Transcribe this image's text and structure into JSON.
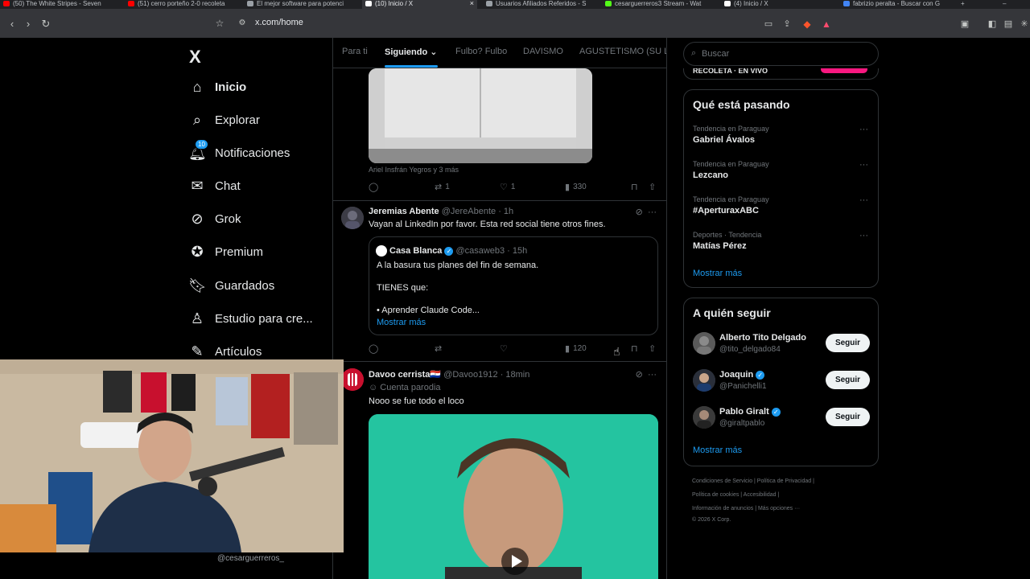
{
  "browser": {
    "tabs": [
      {
        "title": "(50) The White Stripes - Seven",
        "color": "#ff0000"
      },
      {
        "title": "(51) cerro porteño 2-0 recoleta",
        "color": "#ff0000"
      },
      {
        "title": "El mejor software para potenci",
        "color": "#9aa0a6"
      },
      {
        "title": "(10) Inicio / X",
        "color": "#ffffff",
        "active": true
      },
      {
        "title": "Usuarios Afiliados Referidos - S",
        "color": "#9aa0a6"
      },
      {
        "title": "cesarguerreros3 Stream - Wat",
        "color": "#53fc18"
      },
      {
        "title": "(4) Inicio / X",
        "color": "#ffffff"
      },
      {
        "title": "fabrizio peralta - Buscar con G",
        "color": "#4285f4"
      }
    ],
    "url": "x.com/home"
  },
  "nav": {
    "logo": "X",
    "items": [
      {
        "label": "Inicio",
        "icon": "home-icon"
      },
      {
        "label": "Explorar",
        "icon": "search-icon"
      },
      {
        "label": "Notificaciones",
        "icon": "bell-icon",
        "badge": "10"
      },
      {
        "label": "Chat",
        "icon": "mail-icon"
      },
      {
        "label": "Grok",
        "icon": "grok-icon"
      },
      {
        "label": "Premium",
        "icon": "verified-icon"
      },
      {
        "label": "Guardados",
        "icon": "bookmark-icon"
      },
      {
        "label": "Estudio para cre...",
        "icon": "studio-icon"
      },
      {
        "label": "Artículos",
        "icon": "article-icon"
      }
    ]
  },
  "feed": {
    "tabs": [
      "Para ti",
      "Siguiendo",
      "Fulbo? Fulbo",
      "DAVISMO",
      "AGUSTETISMO (SU LID"
    ],
    "tweet0": {
      "tagged": "Ariel Insfrán Yegros y 3 más",
      "retweets": "1",
      "likes": "1",
      "views": "330"
    },
    "tweet1": {
      "name": "Jeremias Abente",
      "handle": "@JereAbente",
      "time": "· 1h",
      "text": "Vayan al LinkedIn por favor. Esta red social tiene otros fines.",
      "quote": {
        "name": "Casa Blanca",
        "handle": "@casaweb3",
        "time": "· 15h",
        "line1": "A la basura tus planes del fin de semana.",
        "line2": "TIENES que:",
        "line3": "• Aprender Claude Code...",
        "more": "Mostrar más"
      },
      "views": "120"
    },
    "tweet2": {
      "name": "Davoo cerrista🇵🇾",
      "handle": "@Davoo1912",
      "time": "· 18min",
      "label": "Cuenta parodia",
      "text": "Nooo se fue todo el loco"
    }
  },
  "sidebar": {
    "search_placeholder": "Buscar",
    "live_label": "RECOLETA · EN VIVO",
    "trends_title": "Qué está pasando",
    "trends": [
      {
        "category": "Tendencia en Paraguay",
        "name": "Gabriel Ávalos"
      },
      {
        "category": "Tendencia en Paraguay",
        "name": "Lezcano"
      },
      {
        "category": "Tendencia en Paraguay",
        "name": "#AperturaxABC"
      },
      {
        "category": "Deportes · Tendencia",
        "name": "Matías Pérez"
      }
    ],
    "trends_more": "Mostrar más",
    "follow_title": "A quién seguir",
    "follow": [
      {
        "name": "Alberto Tito Delgado",
        "handle": "@tito_delgado84",
        "verified": false
      },
      {
        "name": "Joaquin",
        "handle": "@Panichelli1",
        "verified": true
      },
      {
        "name": "Pablo Giralt",
        "handle": "@giraltpablo",
        "verified": true
      }
    ],
    "follow_button": "Seguir",
    "follow_more": "Mostrar más",
    "footer": {
      "line1": "Condiciones de Servicio  |  Política de Privacidad  |",
      "line2": "Política de cookies  |  Accesibilidad  |",
      "line3": "Información de anuncios  |  Más opciones ···",
      "line4": "© 2026 X Corp."
    }
  },
  "webcam": {
    "handle": "@cesarguerreros_"
  }
}
